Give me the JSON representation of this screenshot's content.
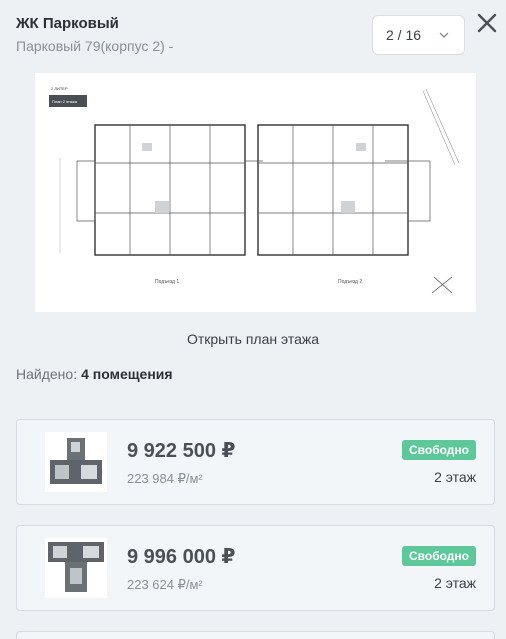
{
  "header": {
    "title": "ЖК Парковый",
    "subtitle": "Парковый 79(корпус 2) -"
  },
  "floor_select": {
    "value": "2 / 16"
  },
  "plan": {
    "tag_title": "2 ЛИТЕР",
    "tag_subtitle": "План 2 этажа",
    "section_left": "Подъезд 1",
    "section_right": "Подъезд 2"
  },
  "open_plan_label": "Открыть план этажа",
  "found": {
    "label": "Найдено:",
    "count_text": "4 помещения"
  },
  "listings": [
    {
      "price": "9 922 500 ₽",
      "price_per_m2": "223 984 ₽/м²",
      "status": "Свободно",
      "floor": "2 этаж"
    },
    {
      "price": "9 996 000 ₽",
      "price_per_m2": "223 624 ₽/м²",
      "status": "Свободно",
      "floor": "2 этаж"
    }
  ],
  "colors": {
    "accent_green": "#5dc89a",
    "background": "#edf1f4"
  }
}
